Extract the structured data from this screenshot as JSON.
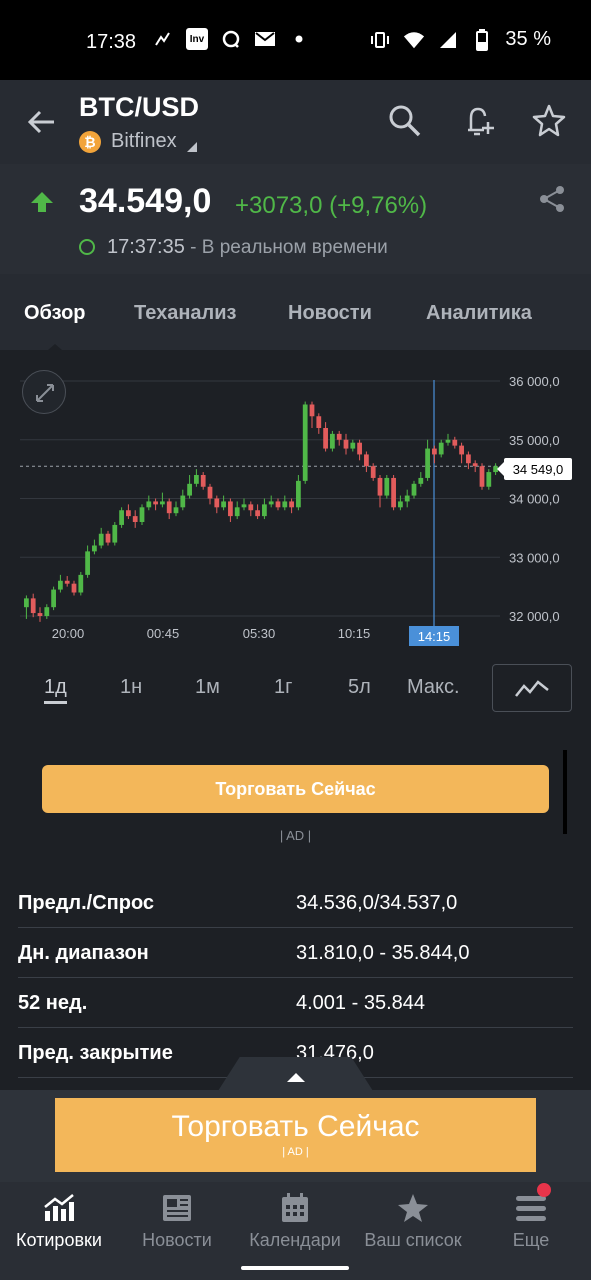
{
  "status_bar": {
    "time": "17:38",
    "battery": "35 %",
    "app_icon_label": "Inv"
  },
  "header": {
    "pair": "BTC/USD",
    "exchange": "Bitfinex",
    "coin_symbol": "₿"
  },
  "quote": {
    "price": "34.549,0",
    "change": "+3073,0 (+9,76%)",
    "time": "17:37:35",
    "realtime_label": "- В реальном времени",
    "change_color": "#50b848"
  },
  "tabs": [
    {
      "label": "Обзор",
      "active": true
    },
    {
      "label": "Теханализ",
      "active": false
    },
    {
      "label": "Новости",
      "active": false
    },
    {
      "label": "Аналитика",
      "active": false
    }
  ],
  "chart_data": {
    "type": "candlestick",
    "y_ticks": [
      "36 000,0",
      "35 000,0",
      "34 000,0",
      "33 000,0",
      "32 000,0"
    ],
    "x_ticks": [
      "20:00",
      "00:45",
      "05:30",
      "10:15"
    ],
    "ylim": [
      32000,
      36000
    ],
    "current_price_label": "34 549,0",
    "crosshair_time": "14:15",
    "up_color": "#50b848",
    "down_color": "#e25c5c",
    "candles": [
      [
        32150,
        32300,
        31950,
        32350
      ],
      [
        32300,
        32050,
        31980,
        32380
      ],
      [
        32050,
        32000,
        31900,
        32150
      ],
      [
        32000,
        32150,
        31950,
        32200
      ],
      [
        32150,
        32450,
        32100,
        32500
      ],
      [
        32450,
        32600,
        32400,
        32700
      ],
      [
        32600,
        32550,
        32500,
        32680
      ],
      [
        32550,
        32400,
        32350,
        32600
      ],
      [
        32400,
        32700,
        32350,
        32750
      ],
      [
        32700,
        33100,
        32650,
        33200
      ],
      [
        33100,
        33200,
        33050,
        33300
      ],
      [
        33200,
        33400,
        33150,
        33500
      ],
      [
        33400,
        33250,
        33200,
        33450
      ],
      [
        33250,
        33550,
        33200,
        33600
      ],
      [
        33550,
        33800,
        33500,
        33850
      ],
      [
        33800,
        33700,
        33650,
        33900
      ],
      [
        33700,
        33600,
        33500,
        33800
      ],
      [
        33600,
        33850,
        33550,
        33900
      ],
      [
        33850,
        33950,
        33800,
        34050
      ],
      [
        33950,
        33900,
        33800,
        34000
      ],
      [
        33900,
        33950,
        33850,
        34100
      ],
      [
        33950,
        33750,
        33650,
        34000
      ],
      [
        33750,
        33850,
        33700,
        33950
      ],
      [
        33850,
        34050,
        33800,
        34150
      ],
      [
        34050,
        34250,
        34000,
        34400
      ],
      [
        34250,
        34400,
        34200,
        34500
      ],
      [
        34400,
        34200,
        34150,
        34450
      ],
      [
        34200,
        34000,
        33900,
        34250
      ],
      [
        34000,
        33850,
        33750,
        34050
      ],
      [
        33850,
        33950,
        33800,
        34050
      ],
      [
        33950,
        33700,
        33600,
        34000
      ],
      [
        33700,
        33850,
        33650,
        33950
      ],
      [
        33850,
        33900,
        33800,
        34000
      ],
      [
        33900,
        33800,
        33700,
        33950
      ],
      [
        33800,
        33700,
        33650,
        33900
      ],
      [
        33700,
        33900,
        33650,
        34000
      ],
      [
        33900,
        33950,
        33850,
        34050
      ],
      [
        33950,
        33850,
        33800,
        34000
      ],
      [
        33850,
        33950,
        33800,
        34050
      ],
      [
        33950,
        33850,
        33750,
        34000
      ],
      [
        33850,
        34300,
        33800,
        34400
      ],
      [
        34300,
        35600,
        34250,
        35650
      ],
      [
        35600,
        35400,
        35200,
        35650
      ],
      [
        35400,
        35200,
        35100,
        35450
      ],
      [
        35200,
        34850,
        34800,
        35300
      ],
      [
        34850,
        35100,
        34800,
        35150
      ],
      [
        35100,
        35000,
        34900,
        35150
      ],
      [
        35000,
        34850,
        34750,
        35100
      ],
      [
        34850,
        34950,
        34800,
        35000
      ],
      [
        34950,
        34750,
        34650,
        35000
      ],
      [
        34750,
        34550,
        34450,
        34800
      ],
      [
        34550,
        34350,
        34300,
        34600
      ],
      [
        34350,
        34050,
        33850,
        34400
      ],
      [
        34050,
        34350,
        34000,
        34400
      ],
      [
        34350,
        33850,
        33800,
        34400
      ],
      [
        33850,
        33950,
        33800,
        34050
      ],
      [
        33950,
        34050,
        33850,
        34150
      ],
      [
        34050,
        34250,
        34000,
        34300
      ],
      [
        34250,
        34350,
        34200,
        34450
      ],
      [
        34350,
        34850,
        34300,
        35000
      ],
      [
        34850,
        34750,
        34600,
        34900
      ],
      [
        34750,
        34950,
        34700,
        35000
      ],
      [
        34950,
        35000,
        34900,
        35100
      ],
      [
        35000,
        34900,
        34850,
        35050
      ],
      [
        34900,
        34750,
        34600,
        34950
      ],
      [
        34750,
        34600,
        34500,
        34800
      ],
      [
        34600,
        34550,
        34450,
        34650
      ],
      [
        34550,
        34200,
        34150,
        34600
      ],
      [
        34200,
        34450,
        34150,
        34500
      ],
      [
        34450,
        34549,
        34400,
        34600
      ]
    ]
  },
  "periods": [
    {
      "label": "1д",
      "active": true
    },
    {
      "label": "1н",
      "active": false
    },
    {
      "label": "1м",
      "active": false
    },
    {
      "label": "1г",
      "active": false
    },
    {
      "label": "5л",
      "active": false
    },
    {
      "label": "Макс.",
      "active": false
    }
  ],
  "trade": {
    "button_label": "Торговать Сейчас",
    "ad_label": "| AD |"
  },
  "stats": [
    {
      "label": "Предл./Спрос",
      "value": "34.536,0/34.537,0"
    },
    {
      "label": "Дн. диапазон",
      "value": "31.810,0 - 35.844,0"
    },
    {
      "label": "52 нед.",
      "value": "4.001 - 35.844"
    },
    {
      "label": "Пред. закрытие",
      "value": "31.476,0"
    }
  ],
  "banner": {
    "label": "Торговать Сейчас",
    "ad_label": "| AD |"
  },
  "bottom_nav": [
    {
      "label": "Котировки",
      "icon": "quotes-chart-icon",
      "active": true
    },
    {
      "label": "Новости",
      "icon": "news-icon",
      "active": false
    },
    {
      "label": "Календари",
      "icon": "calendar-icon",
      "active": false
    },
    {
      "label": "Ваш список",
      "icon": "star-icon",
      "active": false
    },
    {
      "label": "Еще",
      "icon": "menu-icon",
      "active": false
    }
  ]
}
